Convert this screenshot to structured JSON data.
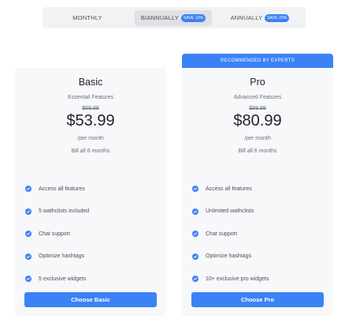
{
  "billing_toggle": {
    "options": [
      {
        "label": "MONTHLY",
        "badge": ""
      },
      {
        "label": "BIANNUALLY",
        "badge": "SAVE 10%"
      },
      {
        "label": "ANNUALLY",
        "badge": "SAVE 20%"
      }
    ],
    "selected": "BIANNUALLY"
  },
  "plans": [
    {
      "name": "Basic",
      "subtitle": "Essentail Features",
      "old_price": "$59.99",
      "price": "$53.99",
      "period": "/per month",
      "billing_note": "Bill all 6 months",
      "features": [
        "Access all features",
        "5 wathclists included",
        "Chat support",
        "Optimize hashtags",
        "5 exclusive widgets"
      ],
      "cta": "Choose Basic"
    },
    {
      "ribbon": "RECOMMENDED BY EXPERTS",
      "name": "Pro",
      "subtitle": "Advanced Features",
      "old_price": "$89.99",
      "price": "$80.99",
      "period": "/per month",
      "billing_note": "Bill all 6 months",
      "features": [
        "Access all features",
        "Unlimited wathclists",
        "Chat support",
        "Optimize hashtags",
        "10+ exclusive pro widgets"
      ],
      "cta": "Choose Pro"
    }
  ],
  "colors": {
    "accent": "#3b82f6",
    "card_bg": "#f7f8fa",
    "toggle_bg": "#f1f2f4",
    "toggle_active": "#dfe1e5"
  },
  "icons": {
    "feature": "check-circle-icon"
  }
}
